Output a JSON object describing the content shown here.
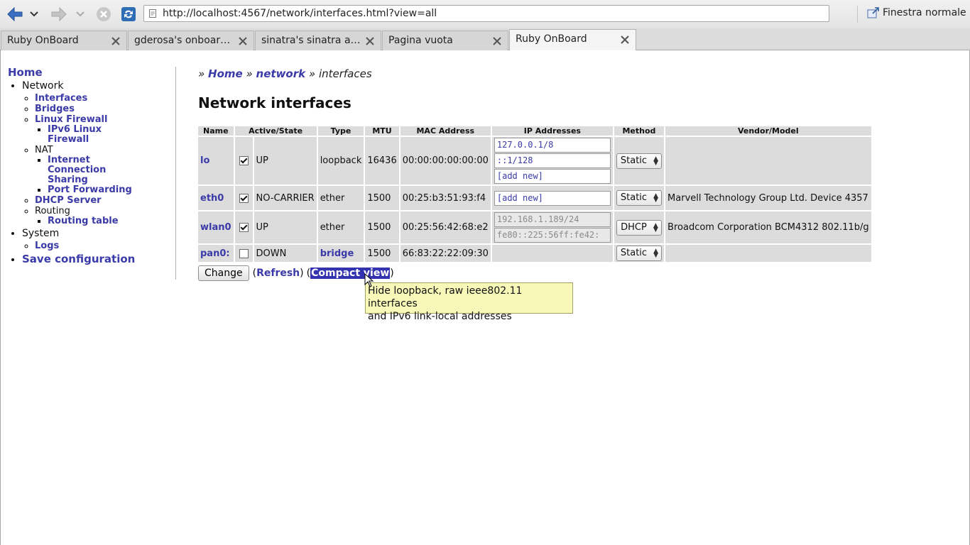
{
  "browser": {
    "url": "http://localhost:4567/network/interfaces.html?view=all",
    "window_mode_label": "Finestra normale",
    "tabs": [
      {
        "title": "Ruby OnBoard",
        "active": false
      },
      {
        "title": "gderosa's onboar…",
        "active": false
      },
      {
        "title": "sinatra's sinatra at …",
        "active": false
      },
      {
        "title": "Pagina vuota",
        "active": false
      },
      {
        "title": "Ruby OnBoard",
        "active": true
      }
    ]
  },
  "sidebar": {
    "home": "Home",
    "network": "Network",
    "interfaces": "Interfaces",
    "bridges": "Bridges",
    "linux_firewall": "Linux Firewall",
    "ipv6_firewall_1": "IPv6 Linux",
    "ipv6_firewall_2": "Firewall",
    "nat": "NAT",
    "ics_1": "Internet",
    "ics_2": "Connection",
    "ics_3": "Sharing",
    "port_forwarding": "Port Forwarding",
    "dhcp_server": "DHCP Server",
    "routing": "Routing",
    "routing_table": "Routing table",
    "system": "System",
    "logs": "Logs",
    "save_configuration": "Save configuration"
  },
  "breadcrumb": {
    "sep": "»",
    "home": "Home",
    "network": "network",
    "current": "interfaces"
  },
  "page_title": "Network interfaces",
  "table": {
    "headers": [
      "Name",
      "Active/State",
      "Type",
      "MTU",
      "MAC Address",
      "IP Addresses",
      "Method",
      "Vendor/Model"
    ],
    "rows": [
      {
        "name": "lo",
        "active": true,
        "state": "UP",
        "type": "loopback",
        "type_is_link": false,
        "mtu": "16436",
        "mac": "00:00:00:00:00:00",
        "ips": [
          "127.0.0.1/8",
          "::1/128",
          "[add new]"
        ],
        "method": "Static",
        "vendor": ""
      },
      {
        "name": "eth0",
        "active": true,
        "state": "NO-CARRIER",
        "type": "ether",
        "type_is_link": false,
        "mtu": "1500",
        "mac": "00:25:b3:51:93:f4",
        "ips": [
          "[add new]"
        ],
        "method": "Static",
        "vendor": "Marvell Technology Group Ltd. Device 4357"
      },
      {
        "name": "wlan0",
        "active": true,
        "state": "UP",
        "type": "ether",
        "type_is_link": false,
        "mtu": "1500",
        "mac": "00:25:56:42:68:e2",
        "ips": [
          "192.168.1.189/24",
          "fe80::225:56ff:fe42:"
        ],
        "method": "DHCP",
        "vendor": "Broadcom Corporation BCM4312 802.11b/g"
      },
      {
        "name": "pan0:",
        "active": false,
        "state": "DOWN",
        "type": "bridge",
        "type_is_link": true,
        "mtu": "1500",
        "mac": "66:83:22:22:09:30",
        "ips": [],
        "method": "Static",
        "vendor": ""
      }
    ]
  },
  "actions": {
    "change": "Change",
    "open_paren": "(",
    "close_paren": ")",
    "refresh": "Refresh",
    "compact_view": "Compact view"
  },
  "tooltip": {
    "line1": "Hide loopback, raw ieee802.11 interfaces",
    "line2": "and IPv6 link-local addresses"
  },
  "colors": {
    "link": "#3a3aa8",
    "highlight": "#3333b0",
    "tooltip_bg": "#f8f8b8",
    "table_cell_bg": "#dcdcdc"
  }
}
